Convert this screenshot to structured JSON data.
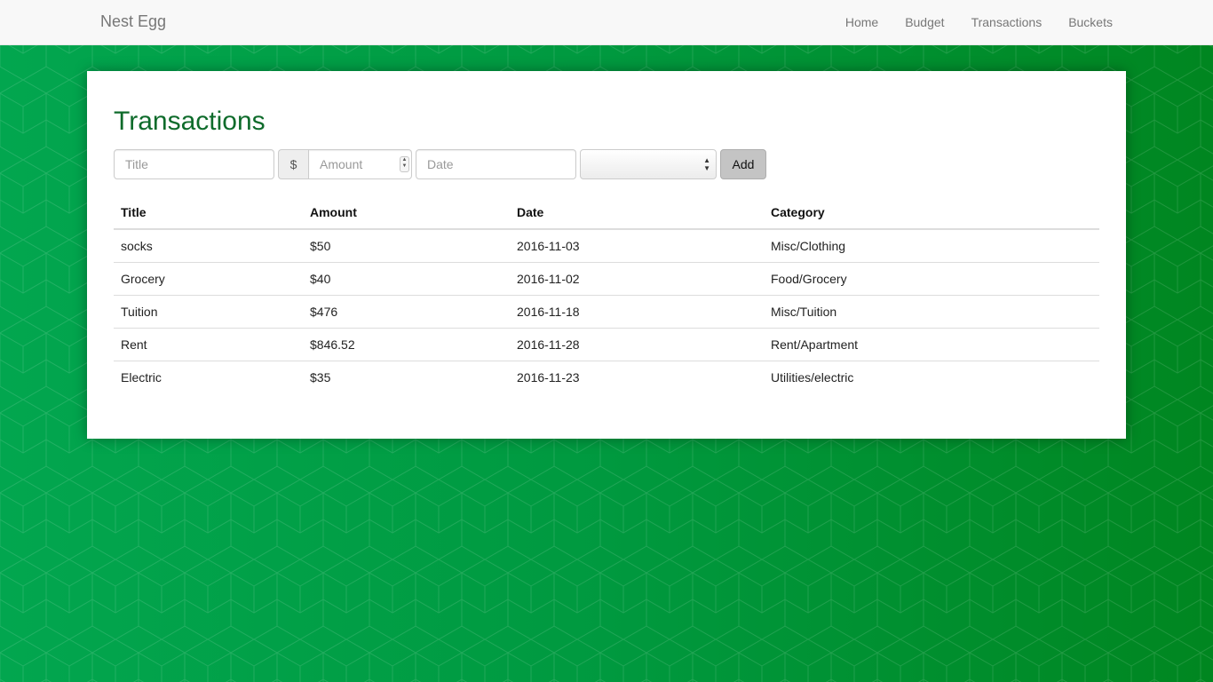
{
  "app": {
    "brand": "Nest Egg"
  },
  "nav": {
    "items": [
      "Home",
      "Budget",
      "Transactions",
      "Buckets"
    ]
  },
  "page": {
    "title": "Transactions"
  },
  "form": {
    "title_placeholder": "Title",
    "currency_symbol": "$",
    "amount_placeholder": "Amount",
    "date_placeholder": "Date",
    "category_selected": "",
    "add_label": "Add"
  },
  "table": {
    "headers": [
      "Title",
      "Amount",
      "Date",
      "Category"
    ],
    "rows": [
      [
        "socks",
        "$50",
        "2016-11-03",
        "Misc/Clothing"
      ],
      [
        "Grocery",
        "$40",
        "2016-11-02",
        "Food/Grocery"
      ],
      [
        "Tuition",
        "$476",
        "2016-11-18",
        "Misc/Tuition"
      ],
      [
        "Rent",
        "$846.52",
        "2016-11-28",
        "Rent/Apartment"
      ],
      [
        "Electric",
        "$35",
        "2016-11-23",
        "Utilities/electric"
      ]
    ]
  },
  "colors": {
    "background_start": "#02a64f",
    "background_end": "#008620",
    "title": "#0e6b2b",
    "navbar": "#f8f8f8"
  }
}
